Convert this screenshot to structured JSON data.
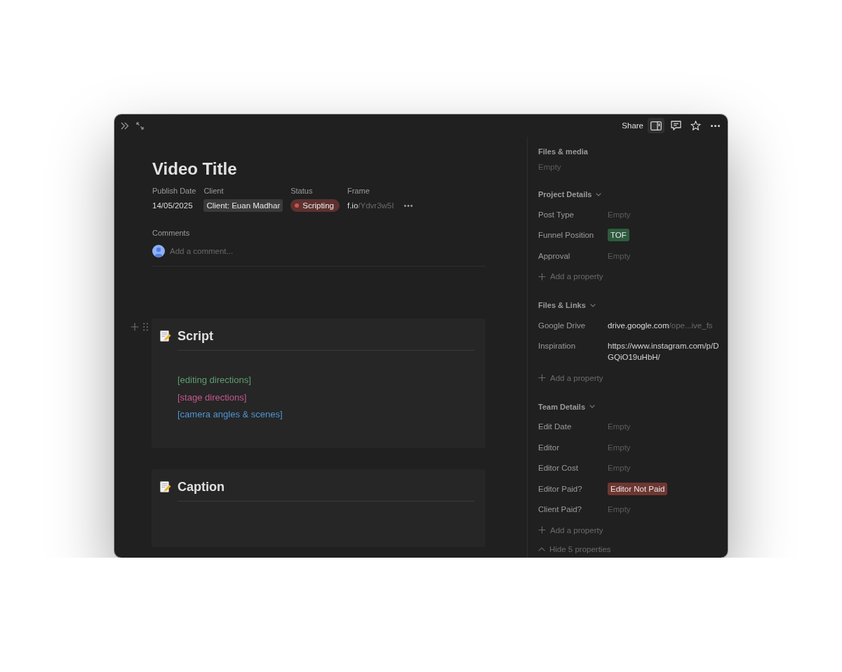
{
  "toolbar": {
    "share": "Share",
    "buttons": [
      {
        "kind": "side_panel",
        "selected": true
      },
      {
        "kind": "comments",
        "selected": false
      },
      {
        "kind": "favorite",
        "selected": false
      },
      {
        "kind": "more",
        "selected": false
      }
    ]
  },
  "page": {
    "title": "Video Title",
    "properties": [
      {
        "label": "Publish Date",
        "kind": "text",
        "value": "14/05/2025"
      },
      {
        "label": "Client",
        "kind": "tag",
        "value": "Client: Euan Madhar",
        "color": "#3a3a3a"
      },
      {
        "label": "Status",
        "kind": "status",
        "value": "Scripting",
        "color": "#d0524a"
      },
      {
        "label": "Frame",
        "kind": "link",
        "value": "f.io",
        "value_tail": "/Ydvr3w5I"
      }
    ],
    "comments": {
      "label": "Comments",
      "placeholder": "Add a comment..."
    }
  },
  "blocks": [
    {
      "title": "Script",
      "hovered": true,
      "lines": [
        {
          "text": "[editing directions]",
          "color": "#5f9e6f"
        },
        {
          "text": "[stage directions]",
          "color": "#c4588d"
        },
        {
          "text": "[camera angles & scenes]",
          "color": "#4d95d6"
        }
      ]
    },
    {
      "title": "Caption",
      "hovered": false
    }
  ],
  "side_panel": {
    "files_media": {
      "label": "Files & media",
      "value": "Empty"
    },
    "sections": [
      {
        "title": "Project Details",
        "expanded": true,
        "properties": [
          {
            "label": "Post Type",
            "kind": "empty",
            "value": "Empty"
          },
          {
            "label": "Funnel Position",
            "kind": "tag",
            "value": "TOF",
            "color": "#2e5b3d"
          },
          {
            "label": "Approval",
            "kind": "empty",
            "value": "Empty"
          }
        ],
        "add_label": "Add a property"
      },
      {
        "title": "Files & Links",
        "expanded": true,
        "properties": [
          {
            "label": "Google Drive",
            "kind": "link",
            "value": "drive.google.com",
            "value_tail": "/ope...ive_fs"
          },
          {
            "label": "Inspiration",
            "kind": "url",
            "value": "https://www.instagram.com/p/DGQiO19uHbH/"
          }
        ],
        "add_label": "Add a property"
      },
      {
        "title": "Team Details",
        "expanded": true,
        "properties": [
          {
            "label": "Edit Date",
            "kind": "empty",
            "value": "Empty"
          },
          {
            "label": "Editor",
            "kind": "empty",
            "value": "Empty"
          },
          {
            "label": "Editor Cost",
            "kind": "empty",
            "value": "Empty"
          },
          {
            "label": "Editor Paid?",
            "kind": "tag",
            "value": "Editor Not Paid",
            "color": "#6e3631"
          },
          {
            "label": "Client Paid?",
            "kind": "empty",
            "value": "Empty"
          }
        ],
        "add_label": "Add a property"
      }
    ],
    "hide_label": "Hide 5 properties"
  }
}
